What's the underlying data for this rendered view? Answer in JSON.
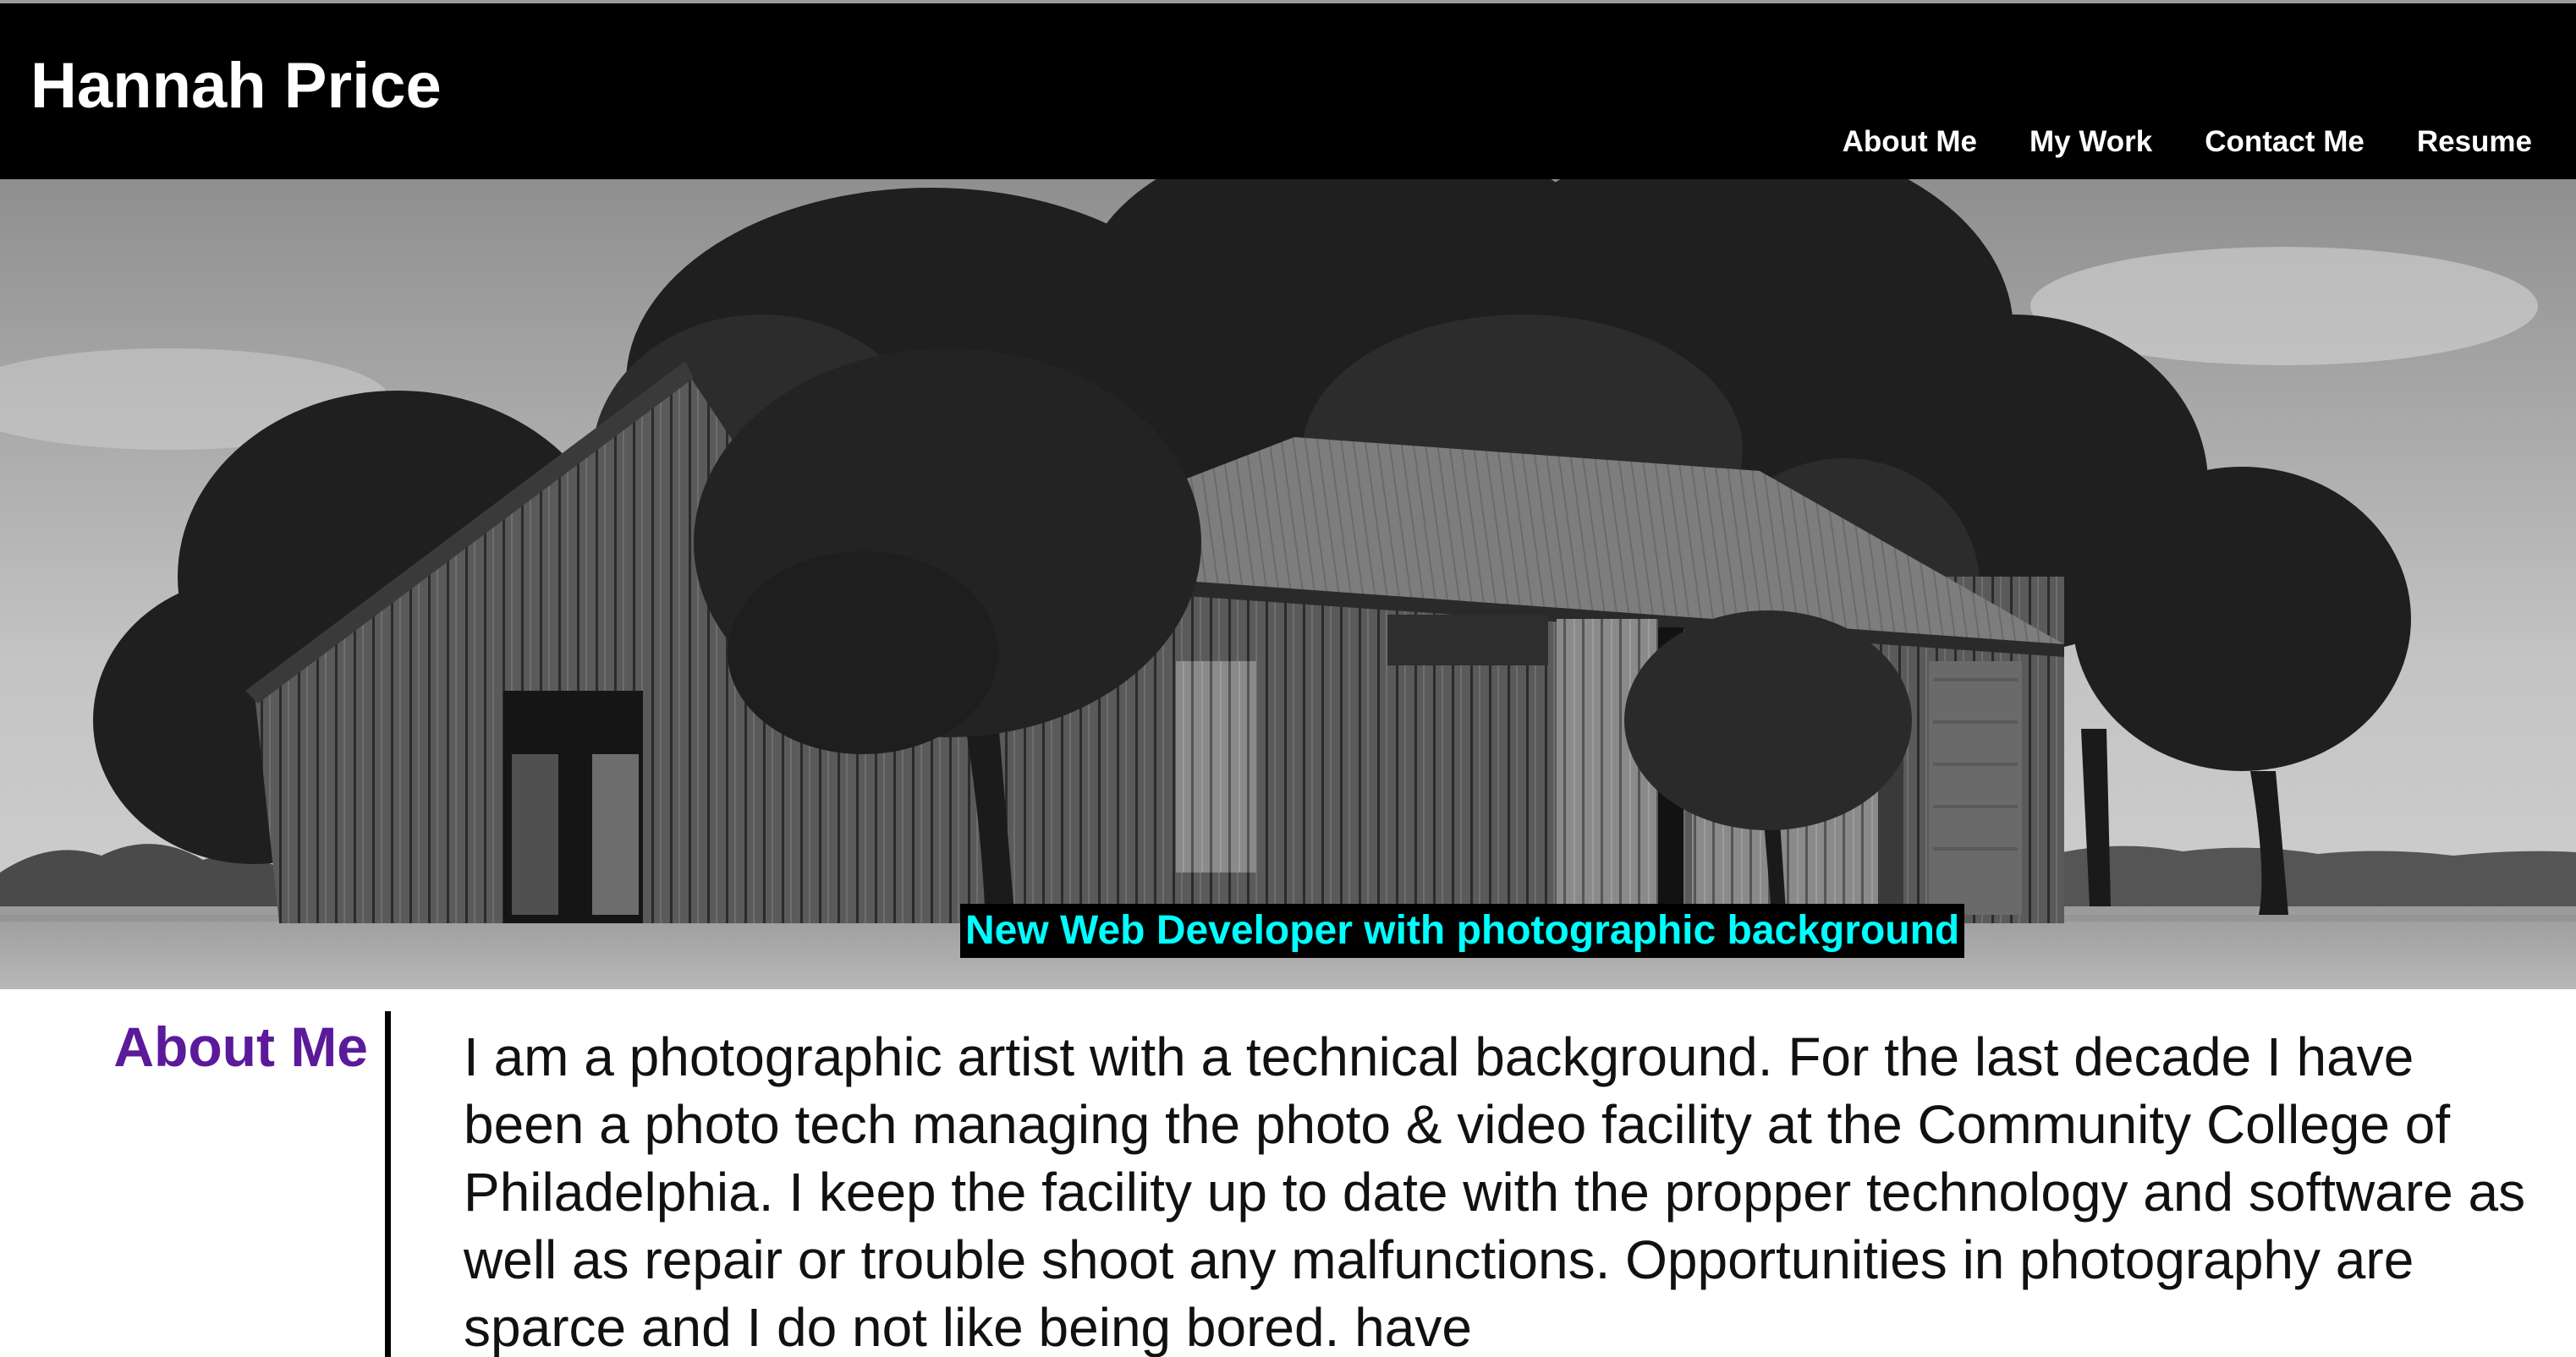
{
  "header": {
    "title": "Hannah Price",
    "nav": [
      {
        "label": "About Me"
      },
      {
        "label": "My Work"
      },
      {
        "label": "Contact Me"
      },
      {
        "label": "Resume"
      }
    ]
  },
  "hero": {
    "image": "black-and-white-barn-photo",
    "tagline": "New Web Developer with photographic background"
  },
  "about": {
    "heading": "About Me",
    "text": "I am a photographic artist with a technical background. For the last decade I have been a photo tech managing the photo & video facility at the Community College of Philadelphia. I keep the facility up to date with the propper technology and software as well as repair or trouble shoot any malfunctions. Opportunities in photography are sparce and I do not like being bored. have"
  },
  "colors": {
    "header_bg": "#000000",
    "nav_text": "#ffffff",
    "tagline_text": "#00ffff",
    "heading_purple": "#5b1a99"
  }
}
